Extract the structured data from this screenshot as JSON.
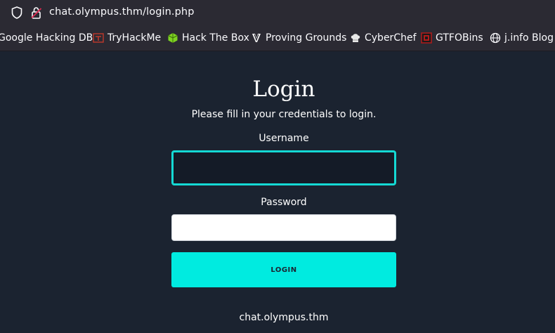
{
  "browser": {
    "url": "chat.olympus.thm/login.php",
    "bookmarks": [
      {
        "label": "Google Hacking DB",
        "icon": "google-hacking-db-icon"
      },
      {
        "label": "TryHackMe",
        "icon": "tryhackme-icon"
      },
      {
        "label": "Hack The Box",
        "icon": "hackthebox-icon"
      },
      {
        "label": "Proving Grounds",
        "icon": "proving-grounds-icon"
      },
      {
        "label": "CyberChef",
        "icon": "cyberchef-icon"
      },
      {
        "label": "GTFOBins",
        "icon": "gtfobins-icon"
      },
      {
        "label": "j.info Blog",
        "icon": "globe-icon"
      }
    ]
  },
  "login": {
    "title": "Login",
    "subtitle": "Please fill in your credentials to login.",
    "username_label": "Username",
    "username_value": "",
    "password_label": "Password",
    "password_value": "",
    "button_label": "LOGIN",
    "footer": "chat.olympus.thm"
  },
  "colors": {
    "page_background": "#1b2330",
    "accent": "#00ebe0",
    "focus_border": "#14d9d4",
    "browser_chrome": "#2b2a33"
  }
}
